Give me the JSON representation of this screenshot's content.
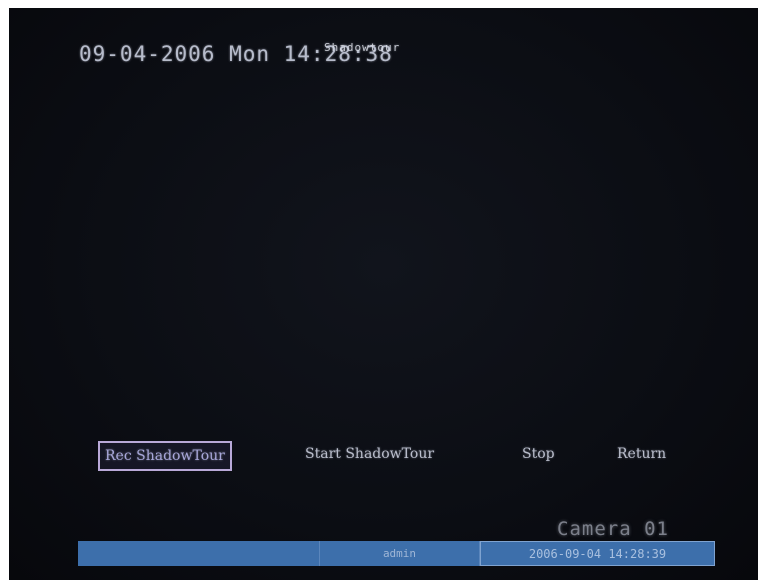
{
  "osd": {
    "datetime": "09-04-2006 Mon 14:28:38",
    "status_text": "Shadowtour"
  },
  "menu": {
    "items": [
      {
        "label": "Rec ShadowTour",
        "selected": true
      },
      {
        "label": "Start ShadowTour",
        "selected": false
      },
      {
        "label": "Stop",
        "selected": false
      },
      {
        "label": "Return",
        "selected": false
      }
    ]
  },
  "camera_label": "Camera 01",
  "status_bar": {
    "left": "",
    "user": "admin",
    "timestamp": "2006-09-04 14:28:39"
  },
  "colors": {
    "video_bg": "#0b0d13",
    "status_bar": "#3d6fab",
    "selection_border": "#b9a9d8",
    "osd_text": "#c9ccd6"
  }
}
